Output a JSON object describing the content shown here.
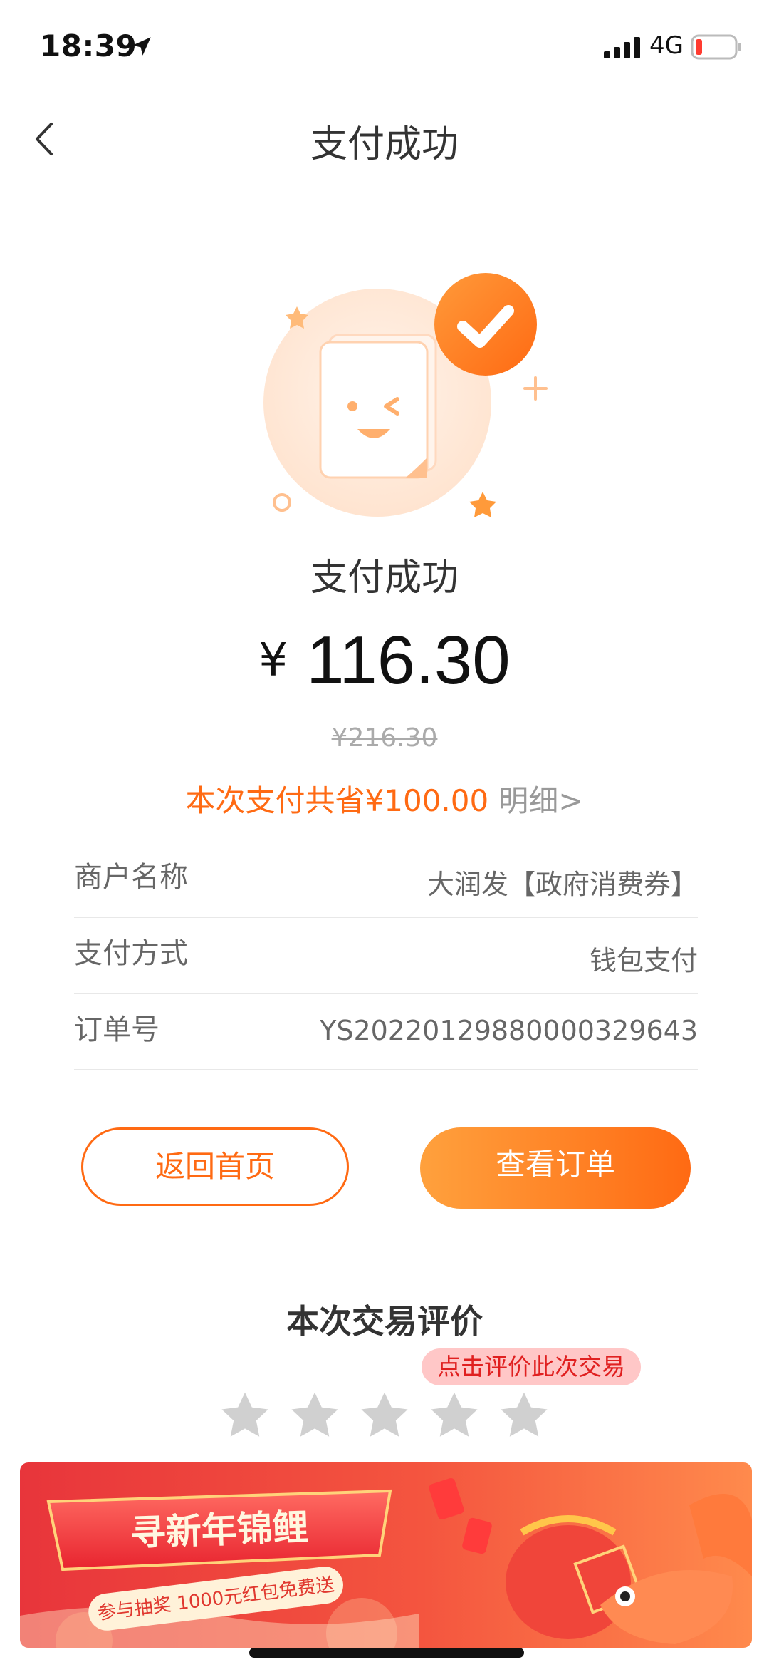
{
  "status_bar": {
    "time": "18:39",
    "network": "4G"
  },
  "nav": {
    "title": "支付成功"
  },
  "result": {
    "title": "支付成功",
    "currency_symbol": "¥",
    "amount": "116.30",
    "original_price": "¥216.30",
    "savings_text": "本次支付共省¥100.00",
    "detail_link": "明细>"
  },
  "info": [
    {
      "label": "商户名称",
      "value": "大润发【政府消费券】"
    },
    {
      "label": "支付方式",
      "value": "钱包支付"
    },
    {
      "label": "订单号",
      "value": "YS20220129880000329643"
    }
  ],
  "buttons": {
    "home": "返回首页",
    "view_order": "查看订单"
  },
  "rating": {
    "title": "本次交易评价",
    "tip": "点击评价此次交易",
    "stars_total": 5,
    "stars_selected": 0
  },
  "banner": {
    "title": "寻新年锦鲤",
    "subtitle": "参与抽奖 1000元红包免费送"
  },
  "colors": {
    "accent": "#ff6a13",
    "accent_light": "#ffa13d",
    "star_empty": "#d0d0d0",
    "tip_bg": "#ffc7c7",
    "tip_text": "#e02020"
  }
}
